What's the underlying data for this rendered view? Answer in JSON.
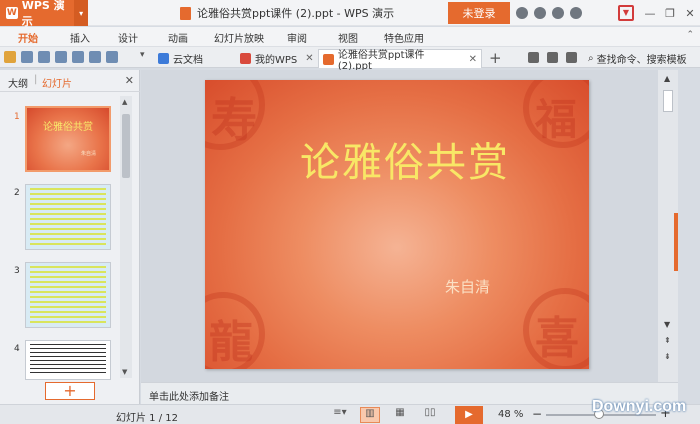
{
  "titlebar": {
    "app_name": "WPS 演示",
    "doc_title": "论雅俗共赏ppt课件 (2).ppt - WPS 演示",
    "login_label": "未登录"
  },
  "menu": {
    "items": [
      "开始",
      "插入",
      "设计",
      "动画",
      "幻灯片放映",
      "审阅",
      "视图",
      "特色应用"
    ],
    "active": "开始"
  },
  "tabs": [
    {
      "label": "云文档",
      "icon": "cloud-doc-icon"
    },
    {
      "label": "我的WPS",
      "icon": "wps-logo-icon"
    },
    {
      "label": "论雅俗共赏ppt课件 (2).ppt",
      "icon": "ppt-file-icon",
      "active": true
    }
  ],
  "search_command": "查找命令、搜索模板",
  "left_panel": {
    "tab_outline": "大纲",
    "tab_slides": "幻灯片",
    "slide_numbers": [
      "1",
      "2",
      "3",
      "4"
    ],
    "thumb1_title": "论雅俗共赏",
    "thumb1_author": "朱自清",
    "add_slide": "+"
  },
  "slide": {
    "title": "论雅俗共赏",
    "author": "朱自清"
  },
  "notes_placeholder": "单击此处添加备注",
  "statusbar": {
    "slide_counter": "幻灯片 1 / 12",
    "zoom": "48 %",
    "zoom_fraction": 0.48
  },
  "watermark": "Downyi.com",
  "colors": {
    "accent": "#e56a2e",
    "title_yellow": "#f8e766"
  }
}
